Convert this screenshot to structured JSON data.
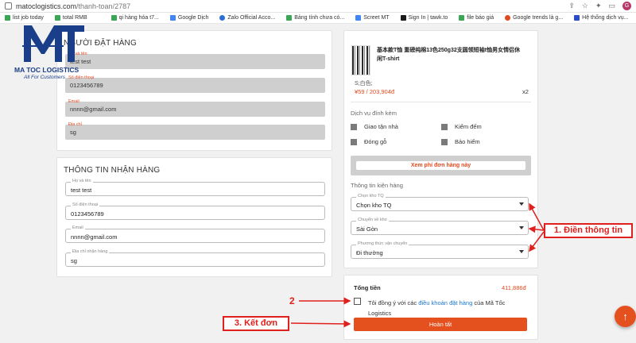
{
  "browser": {
    "url_domain": "matoclogistics.com",
    "url_path": "/thanh-toan/2787",
    "avatar_letter": "G",
    "bookmarks": [
      {
        "label": "list job today",
        "color": "#3aa757"
      },
      {
        "label": "total RMB",
        "color": "#3aa757"
      },
      {
        "label": "qi hàng hóa t7...",
        "color": "#3aa757"
      },
      {
        "label": "Google Dịch",
        "color": "#4285f4"
      },
      {
        "label": "Zalo Official Acco...",
        "color": "#2b6fd6"
      },
      {
        "label": "Bảng tính chưa có...",
        "color": "#3aa757"
      },
      {
        "label": "Screet MT",
        "color": "#4285f4"
      },
      {
        "label": "Sign In | tawk.to",
        "color": "#1a1a1a"
      },
      {
        "label": "file báo giá",
        "color": "#3aa757"
      },
      {
        "label": "Google trends là g...",
        "color": "#e04a1e"
      },
      {
        "label": "Hệ thống dịch vụ...",
        "color": "#2b4cc8"
      }
    ]
  },
  "logo": {
    "name": "MA TOC LOGISTICS",
    "slogan": "All For Customers"
  },
  "sender": {
    "title": "NGƯỜI ĐẶT HÀNG",
    "fields": [
      {
        "label": "Họ và tên",
        "value": "test test"
      },
      {
        "label": "Số điện thoại",
        "value": "0123456789"
      },
      {
        "label": "Email",
        "value": "nnnn@gmail.com"
      },
      {
        "label": "Địa chỉ",
        "value": "sg"
      }
    ]
  },
  "receiver": {
    "title": "THÔNG TIN NHẬN HÀNG",
    "fields": [
      {
        "label": "Họ và tên",
        "value": "test test"
      },
      {
        "label": "Số điện thoại",
        "value": "0123456789"
      },
      {
        "label": "Email",
        "value": "nnnn@gmail.com"
      },
      {
        "label": "Địa chỉ nhận hàng",
        "value": "sg"
      }
    ]
  },
  "product": {
    "name": "基本款T恤 重磅纯棉13色250g32支圆领短袖t恤男女情侣休闲T-shirt",
    "variant": "S;白色;",
    "price": "¥59 / 203,904đ",
    "quantity": "x2"
  },
  "services": {
    "title": "Dịch vụ đính kèm",
    "items": [
      "Giao tận nhà",
      "Kiểm đếm",
      "Đóng gỗ",
      "Bảo hiểm"
    ],
    "fee_button": "Xem phí đơn hàng này"
  },
  "shipment": {
    "title": "Thông tin kiện hàng",
    "selects": [
      {
        "label": "Chọn kho TQ",
        "value": "Chọn kho TQ"
      },
      {
        "label": "Chuyển về kho",
        "value": "Sài Gòn"
      },
      {
        "label": "Phương thức vận chuyển",
        "value": "Đi thường"
      }
    ]
  },
  "summary": {
    "total_label": "Tổng tiền",
    "total_value": "411,886đ",
    "agree_prefix": "Tôi đồng ý với các ",
    "agree_link": "điều khoản đặt hàng",
    "agree_suffix": " của Mã Tốc Logistics",
    "submit": "Hoàn tất"
  },
  "fab_icon": "arrow-up-icon",
  "annotations": {
    "step1": "1. Điền thông tin",
    "step2": "2",
    "step3": "3. Kết đơn",
    "color": "#e0201c"
  }
}
